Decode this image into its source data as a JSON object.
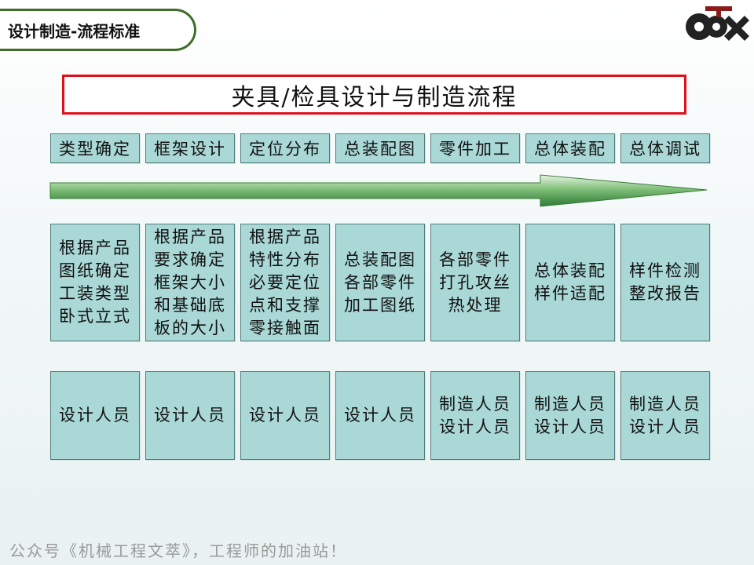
{
  "header": {
    "title": "设计制造-流程标准"
  },
  "logo": {
    "icon": "company-logo"
  },
  "main_title": "夹具/检具设计与制造流程",
  "colors": {
    "cell_bg": "#a9d8d6",
    "title_border": "#e0101a",
    "tab_border": "#3f6e2b",
    "arrow": "#3a8a3e"
  },
  "steps": [
    "类型确定",
    "框架设计",
    "定位分布",
    "总装配图",
    "零件加工",
    "总体装配",
    "总体调试"
  ],
  "descriptions": [
    "根据产品\n图纸确定\n工装类型\n卧式立式",
    "根据产品\n要求确定\n框架大小\n和基础底\n板的大小",
    "根据产品\n特性分布\n必要定位\n点和支撑\n零接触面",
    "总装配图\n各部零件\n加工图纸",
    "各部零件\n打孔攻丝\n热处理",
    "总体装配\n样件适配",
    "样件检测\n整改报告"
  ],
  "personnel": [
    "设计人员",
    "设计人员",
    "设计人员",
    "设计人员",
    "制造人员\n设计人员",
    "制造人员\n设计人员",
    "制造人员\n设计人员"
  ],
  "footer": "公众号《机械工程文萃》，工程师的加油站！"
}
